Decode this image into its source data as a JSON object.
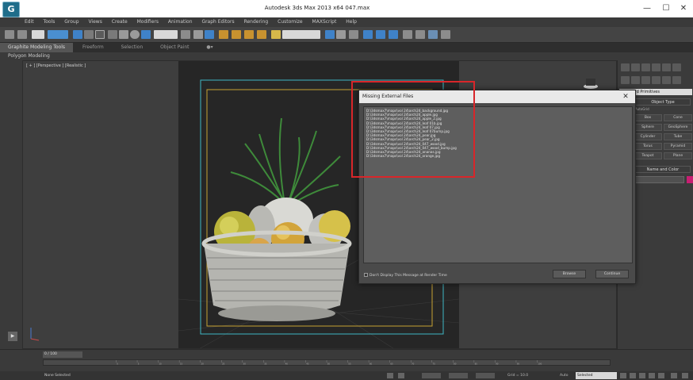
{
  "window": {
    "title": "Autodesk 3ds Max 2013 x64      047.max",
    "logo_letter": "G",
    "minimize": "—",
    "maximize": "☐",
    "close": "✕"
  },
  "menubar": {
    "items": [
      "Edit",
      "Tools",
      "Group",
      "Views",
      "Create",
      "Modifiers",
      "Animation",
      "Graph Editors",
      "Rendering",
      "Customize",
      "MAXScript",
      "Help"
    ]
  },
  "ribbon": {
    "tabs": [
      "Graphite Modeling Tools",
      "Freeform",
      "Selection",
      "Object Paint"
    ],
    "active_tab": 0,
    "subpanel": "Polygon Modeling"
  },
  "viewport": {
    "label": "[ + ] [Perspective ] [Realistic ]"
  },
  "command_panel": {
    "dropdown": "Standard Primitives",
    "section_object_type": "Object Type",
    "autogrid": "AutoGrid",
    "buttons": [
      "Box",
      "Cone",
      "Sphere",
      "GeoSphere",
      "Cylinder",
      "Tube",
      "Torus",
      "Pyramid",
      "Teapot",
      "Plane"
    ],
    "section_name_color": "Name and Color",
    "swatch_color": "#c81e72"
  },
  "dialog": {
    "title": "Missing External Files",
    "close": "✕",
    "files": [
      "D:\\3dsmax7\\maps\\vol 24\\arch24_background.jpg",
      "D:\\3dsmax7\\maps\\vol 24\\arch24_apple.jpg",
      "D:\\3dsmax7\\maps\\vol 24\\arch24_apple_2.jpg",
      "D:\\3dsmax7\\maps\\vol 24\\arch24_leaf 01b.jpg",
      "D:\\3dsmax7\\maps\\vol 24\\arch24_leaf 07.jpg",
      "D:\\3dsmax7\\maps\\vol 24\\arch24_leaf 07bump.jpg",
      "D:\\3dsmax7\\maps\\vol 24\\arch24_pear.jpg",
      "D:\\3dsmax7\\maps\\vol 24\\arch24_pear_2.jpg",
      "D:\\3dsmax7\\maps\\vol 24\\arch24_047_wood.jpg",
      "D:\\3dsmax7\\maps\\vol 24\\arch24_047_wood_bump.jpg",
      "D:\\3dsmax7\\maps\\vol 24\\arch24_ananas.jpg",
      "D:\\3dsmax7\\maps\\vol 24\\arch24_orange.jpg"
    ],
    "dont_display": "Don't Display This Message at Render Time",
    "browse_label": "Browse",
    "continue_label": "Continue",
    "highlight_color": "#d8262a"
  },
  "timeline": {
    "frame_label": "0 / 100",
    "ticks": [
      "0",
      "5",
      "10",
      "15",
      "20",
      "25",
      "30",
      "35",
      "40",
      "45",
      "50",
      "55",
      "60",
      "65",
      "70",
      "75",
      "80",
      "85",
      "90",
      "95",
      "100"
    ]
  },
  "status": {
    "selection_text": "None Selected",
    "grid": "Grid = 10.0",
    "auto_key": "Auto",
    "selection_filter": "Selected"
  },
  "colors": {
    "app_bg": "#3c3c3c",
    "render_bg": "#262626",
    "safe_frame_cyan": "#3fb7c4",
    "safe_frame_yellow": "#c7a233"
  }
}
